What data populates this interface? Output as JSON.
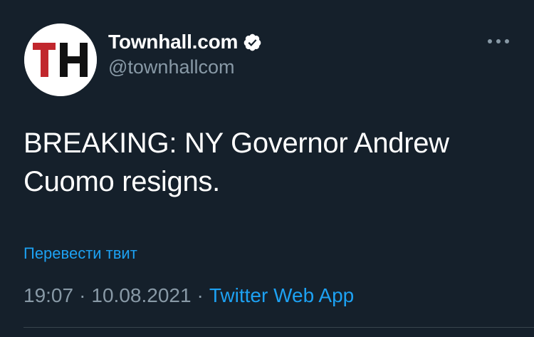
{
  "account": {
    "avatar_logo_text": "TH",
    "display_name": "Townhall.com",
    "handle": "@townhallcom",
    "verified": true
  },
  "tweet": {
    "text": "BREAKING: NY Governor Andrew Cuomo resigns.",
    "translate_link": "Перевести твит",
    "time": "19:07",
    "separator": "·",
    "date": "10.08.2021",
    "source": "Twitter Web App"
  },
  "icons": {
    "verified": "verified-badge-icon",
    "more": "more-options-icon"
  },
  "colors": {
    "background": "#15202b",
    "text_primary": "#ffffff",
    "text_secondary": "#8899a6",
    "accent": "#1da1f2",
    "logo_red": "#c1272d",
    "logo_black": "#111111",
    "divider": "#38444d"
  }
}
